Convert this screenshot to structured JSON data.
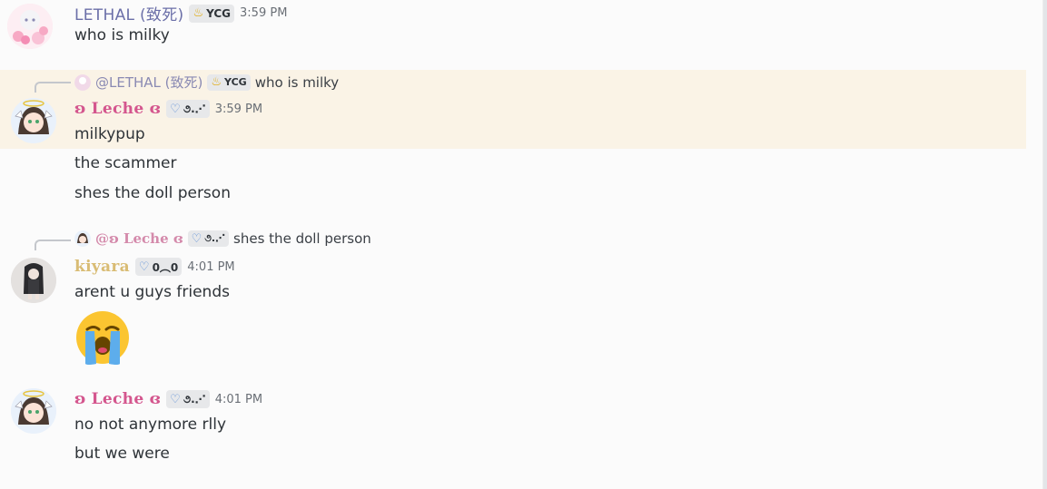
{
  "messages": [
    {
      "author": "LETHAL (致死)",
      "tag": "YCG",
      "time": "3:59 PM",
      "lines": [
        "who is milky"
      ]
    },
    {
      "reply": {
        "mention": "@LETHAL (致死)",
        "tag": "YCG",
        "text": "who is milky"
      },
      "author": "ʚ Leche ɞ",
      "tag": "૭.⋰",
      "time": "3:59 PM",
      "lines": [
        "milkypup",
        "the scammer",
        "shes the doll person"
      ]
    },
    {
      "reply": {
        "mention": "@ʚ Leche ɞ",
        "tag": "૭.⋰",
        "text": "shes the doll person"
      },
      "author": "kiyara",
      "tag": "0︵0",
      "time": "4:01 PM",
      "lines": [
        "arent u guys friends"
      ],
      "emoji": "loudly-crying-face"
    },
    {
      "author": "ʚ Leche ɞ",
      "tag": "૭.⋰",
      "time": "4:01 PM",
      "lines": [
        "no not anymore rlly",
        "but we were"
      ]
    }
  ],
  "colors": {
    "highlight": "#faf3e6",
    "leche": "#d4568e",
    "kiyara": "#d9bc74",
    "lethal": "#6b6fa8"
  }
}
